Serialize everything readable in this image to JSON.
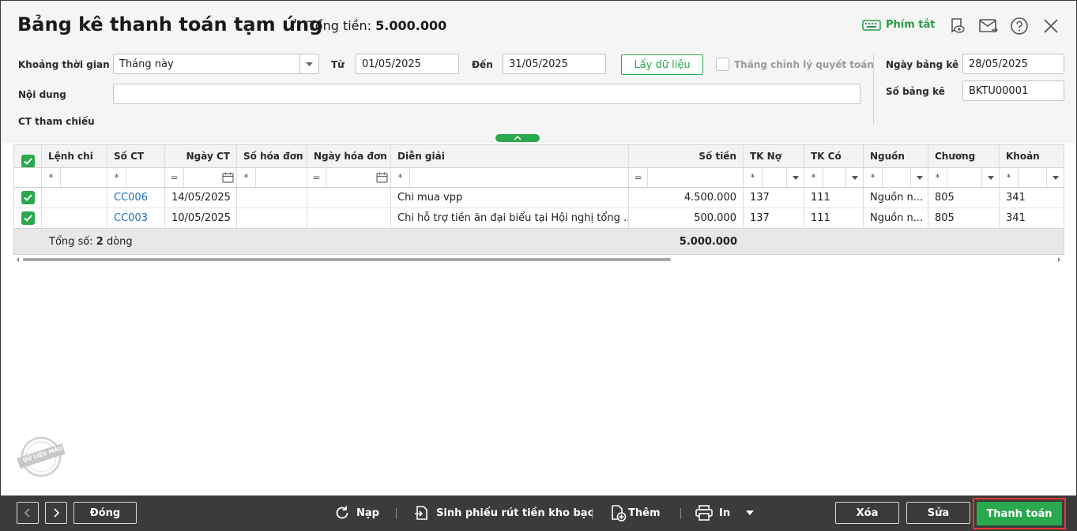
{
  "header": {
    "title": "Bảng kê thanh toán tạm ứng",
    "total_label": "Tổng tiền:",
    "total_value": "5.000.000",
    "shortcut_label": "Phím tắt",
    "icons": [
      "keyboard-icon",
      "bookmark-eye-icon",
      "mail-icon",
      "help-icon",
      "close-icon"
    ]
  },
  "filters": {
    "period_label": "Khoảng thời gian",
    "period_value": "Tháng này",
    "from_label": "Từ",
    "from_value": "01/05/2025",
    "to_label": "Đến",
    "to_value": "31/05/2025",
    "get_data_button": "Lấy dữ liệu",
    "adjust_month_label": "Tháng chỉnh lý quyết toán",
    "content_label": "Nội dung",
    "content_value": "",
    "reference_label": "CT tham chiếu",
    "list_date_label": "Ngày bảng kê",
    "list_date_value": "28/05/2025",
    "list_no_label": "Số bảng kê",
    "list_no_value": "BKTU00001"
  },
  "table": {
    "columns": [
      "Lệnh chi",
      "Số CT",
      "Ngày CT",
      "Số hóa đơn",
      "Ngày hóa đơn",
      "Diễn giải",
      "Số tiền",
      "TK Nợ",
      "TK Có",
      "Nguồn",
      "Chương",
      "Khoản"
    ],
    "filter_ops": [
      "*",
      "*",
      "=",
      "*",
      "=",
      "*",
      "=",
      "*",
      "*",
      "*",
      "*",
      "*"
    ],
    "rows": [
      {
        "lenh_chi": "",
        "so_ct": "CC006",
        "ngay_ct": "14/05/2025",
        "so_hd": "",
        "ngay_hd": "",
        "dien_giai": "Chi mua vpp",
        "so_tien": "4.500.000",
        "tk_no": "137",
        "tk_co": "111",
        "nguon": "Nguồn n...",
        "chuong": "805",
        "khoan": "341"
      },
      {
        "lenh_chi": "",
        "so_ct": "CC003",
        "ngay_ct": "10/05/2025",
        "so_hd": "",
        "ngay_hd": "",
        "dien_giai": "Chi hỗ trợ tiền ăn đại biểu tại Hội nghị tổng ...",
        "so_tien": "500.000",
        "tk_no": "137",
        "tk_co": "111",
        "nguon": "Nguồn n...",
        "chuong": "805",
        "khoan": "341"
      }
    ],
    "footer_label": "Tổng số:",
    "footer_count": "2",
    "footer_unit": "dòng",
    "footer_total": "5.000.000"
  },
  "stamp_text": "DỮ LIỆU MẪU",
  "toolbar": {
    "close_label": "Đóng",
    "reload_label": "Nạp",
    "generate_label": "Sinh phiếu rút tiền kho bạc",
    "add_label": "Thêm",
    "print_label": "In",
    "delete_label": "Xóa",
    "edit_label": "Sửa",
    "pay_label": "Thanh toán"
  },
  "colors": {
    "accent_green": "#2aa84d",
    "link_blue": "#1f6fc5",
    "toolbar_bg": "#3b3b3b",
    "highlight_red": "#e53935"
  }
}
